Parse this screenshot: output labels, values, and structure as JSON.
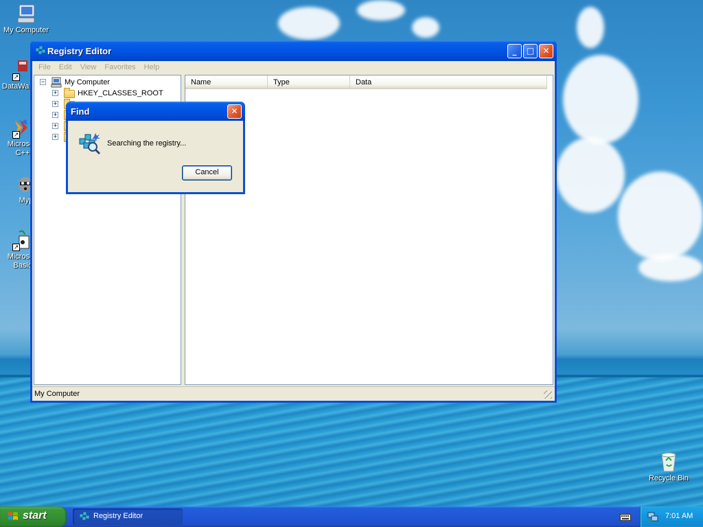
{
  "desktop": {
    "icons": [
      {
        "label": "My Computer"
      },
      {
        "label": "DataWa"
      },
      {
        "label": "Microsoft C++",
        "line1": "Microsoft",
        "line2": "C++"
      },
      {
        "label": "Myp"
      },
      {
        "label": "Microsoft Basic",
        "line1": "Microsoft",
        "line2": "Basic"
      },
      {
        "label": "Recycle Bin"
      }
    ]
  },
  "regedit": {
    "title": "Registry Editor",
    "menu": [
      "File",
      "Edit",
      "View",
      "Favorites",
      "Help"
    ],
    "tree": {
      "root": "My Computer",
      "items": [
        "HKEY_CLASSES_ROOT"
      ]
    },
    "columns": [
      "Name",
      "Type",
      "Data"
    ],
    "status": "My Computer"
  },
  "find_dialog": {
    "title": "Find",
    "message": "Searching the registry...",
    "cancel_label": "Cancel"
  },
  "taskbar": {
    "start_label": "start",
    "task_label": "Registry Editor",
    "clock": "7:01 AM"
  }
}
